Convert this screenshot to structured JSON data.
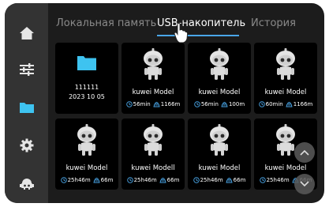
{
  "tabs": [
    {
      "label": "Локальная память"
    },
    {
      "label": "USB-накопитель"
    },
    {
      "label": "История"
    }
  ],
  "sidebar": {
    "items": [
      {
        "icon": "home-icon"
      },
      {
        "icon": "sliders-icon"
      },
      {
        "icon": "folder-icon"
      },
      {
        "icon": "gear-icon"
      },
      {
        "icon": "robot-icon"
      }
    ],
    "active_index": 2
  },
  "files": {
    "folder": {
      "name": "111111",
      "date": "2023 10 05"
    },
    "models": [
      {
        "name": "kuwei Model",
        "time": "56min",
        "length": "1166m"
      },
      {
        "name": "kuwei Model",
        "time": "56min",
        "length": "100m"
      },
      {
        "name": "kuwei Model",
        "time": "60min",
        "length": "1166m"
      },
      {
        "name": "kuwei Model",
        "time": "25h46m",
        "length": "66m"
      },
      {
        "name": "kuwei Modell",
        "time": "25h46m",
        "length": "66m"
      },
      {
        "name": "kuwei Model",
        "time": "25h46m",
        "length": "66m"
      },
      {
        "name": "kuwei Model",
        "time": "25h46m",
        "length": "66m"
      }
    ]
  },
  "colors": {
    "accent": "#4aa6e8",
    "folder": "#3ec3f0",
    "background": "#1c1c1c",
    "sidebar": "#333333"
  }
}
